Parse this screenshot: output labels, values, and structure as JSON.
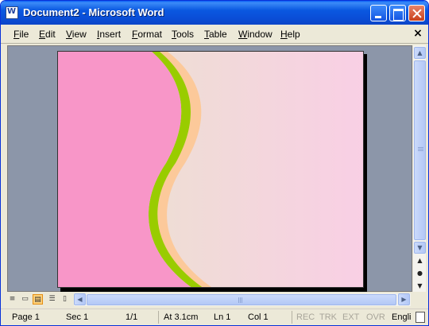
{
  "window": {
    "title": "Document2 - Microsoft Word"
  },
  "menu": {
    "items": [
      "File",
      "Edit",
      "View",
      "Insert",
      "Format",
      "Tools",
      "Table",
      "Window",
      "Help"
    ],
    "close_glyph": "×"
  },
  "document": {
    "background_colors": {
      "pink": "#f896c8",
      "beige": "#e9e5cc",
      "light_pink": "#f9cfe5",
      "green": "#99cc00",
      "peach": "#fcc99a"
    }
  },
  "scrollbar": {
    "up_glyph": "▲",
    "down_glyph": "▼",
    "prev_page_glyph": "▲",
    "select_browse_glyph": "●",
    "next_page_glyph": "▼"
  },
  "view_buttons": [
    "normal-view",
    "web-layout-view",
    "print-layout-view",
    "outline-view",
    "reading-layout-view"
  ],
  "status": {
    "page": "Page 1",
    "sec": "Sec 1",
    "pages": "1/1",
    "at": "At 3.1cm",
    "ln": "Ln 1",
    "col": "Col 1",
    "rec": "REC",
    "trk": "TRK",
    "ext": "EXT",
    "ovr": "OVR",
    "language": "Engli"
  }
}
